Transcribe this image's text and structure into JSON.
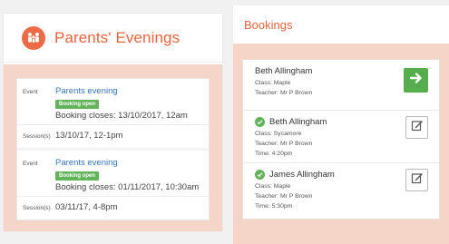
{
  "left": {
    "title": "Parents' Evenings",
    "events": [
      {
        "event_label": "Event",
        "name": "Parents evening",
        "badge": "Booking open",
        "closes": "Booking closes: 13/10/2017, 12am",
        "session_label": "Session(s)",
        "session": "13/10/17, 12-1pm"
      },
      {
        "event_label": "Event",
        "name": "Parents evening",
        "badge": "Booking open",
        "closes": "Booking closes: 01/11/2017, 10:30am",
        "session_label": "Session(s)",
        "session": "03/11/17, 4-8pm"
      }
    ]
  },
  "right": {
    "title": "Bookings",
    "bookings": [
      {
        "name": "Beth Allingham",
        "class": "Class: Maple",
        "teacher": "Teacher: Mr P Brown",
        "time": "",
        "action": "go"
      },
      {
        "name": "Beth Allingham",
        "class": "Class: Sycamore",
        "teacher": "Teacher: Mr P Brown",
        "time": "Time: 4:20pm",
        "action": "edit"
      },
      {
        "name": "James Allingham",
        "class": "Class: Maple",
        "teacher": "Teacher: Mr P Brown",
        "time": "Time: 5:30pm",
        "action": "edit"
      }
    ]
  },
  "colors": {
    "accent": "#e8643f",
    "panel_bg": "#f6d5c9",
    "badge_green": "#62b35a",
    "link": "#3a74b3"
  },
  "icons": [
    "family-icon",
    "arrow-right-icon",
    "checkmark-icon",
    "edit-icon"
  ]
}
